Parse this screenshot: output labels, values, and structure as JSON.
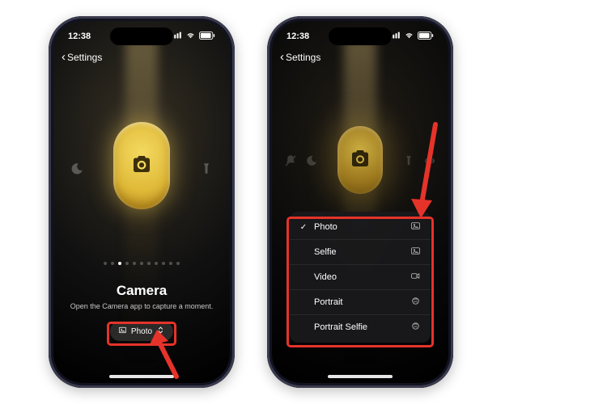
{
  "status": {
    "time": "12:38"
  },
  "nav": {
    "back_label": "Settings"
  },
  "pager": {
    "count": 11,
    "active_index": 2
  },
  "feature": {
    "title": "Camera",
    "description": "Open the Camera app to capture a moment."
  },
  "picker": {
    "selected": "Photo"
  },
  "menu": [
    {
      "label": "Photo",
      "checked": true,
      "icon": "photo-icon"
    },
    {
      "label": "Selfie",
      "checked": false,
      "icon": "photo-icon"
    },
    {
      "label": "Video",
      "checked": false,
      "icon": "video-icon"
    },
    {
      "label": "Portrait",
      "checked": false,
      "icon": "portrait-icon"
    },
    {
      "label": "Portrait Selfie",
      "checked": false,
      "icon": "portrait-icon"
    }
  ],
  "annotation": {
    "color": "#e6332a"
  }
}
